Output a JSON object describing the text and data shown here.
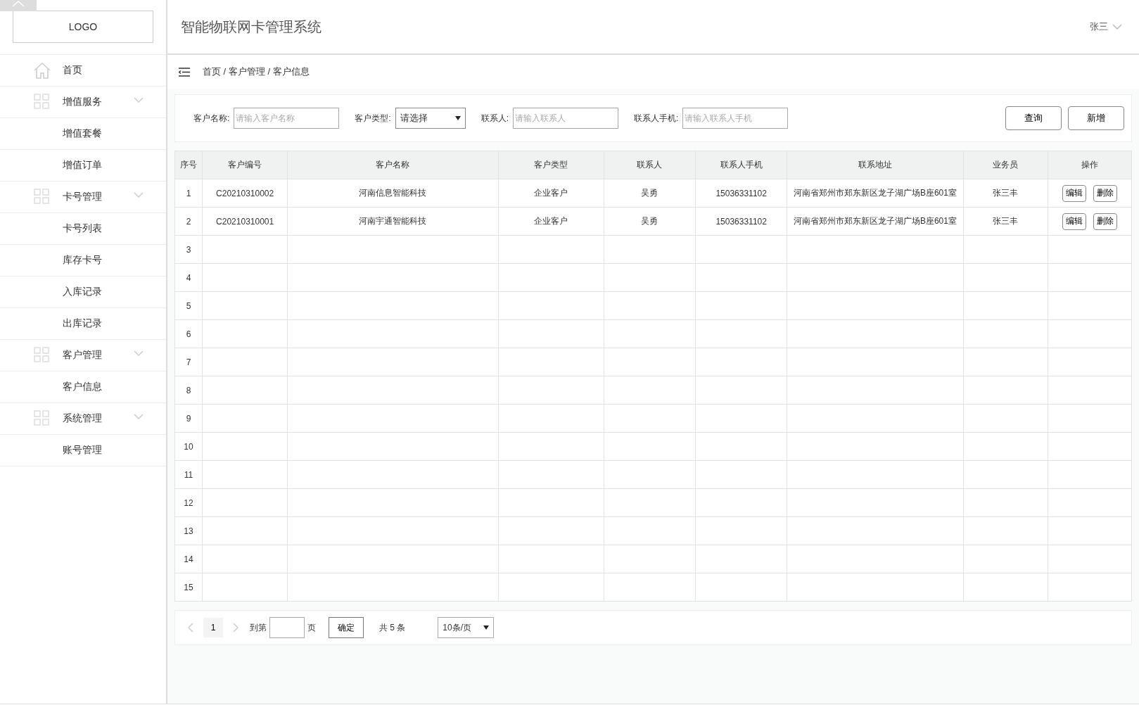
{
  "sidebar": {
    "logo": "LOGO",
    "items": [
      {
        "kind": "home",
        "label": "首页"
      },
      {
        "kind": "group",
        "label": "增值服务",
        "expanded": true,
        "children": [
          {
            "label": "增值套餐"
          },
          {
            "label": "增值订单"
          }
        ]
      },
      {
        "kind": "group",
        "label": "卡号管理",
        "expanded": true,
        "children": [
          {
            "label": "卡号列表"
          },
          {
            "label": "库存卡号"
          },
          {
            "label": "入库记录"
          },
          {
            "label": "出库记录"
          }
        ]
      },
      {
        "kind": "group",
        "label": "客户管理",
        "expanded": true,
        "children": [
          {
            "label": "客户信息"
          }
        ]
      },
      {
        "kind": "group",
        "label": "系统管理",
        "expanded": true,
        "children": [
          {
            "label": "账号管理"
          }
        ]
      }
    ]
  },
  "header": {
    "title": "智能物联网卡管理系统",
    "user": "张三"
  },
  "breadcrumb": "首页 / 客户管理 / 客户信息",
  "filters": [
    {
      "kind": "input",
      "label": "客户名称:",
      "placeholder": "请输入客户名称"
    },
    {
      "kind": "select",
      "label": "客户类型:",
      "value": "请选择"
    },
    {
      "kind": "input",
      "label": "联系人:",
      "placeholder": "请输入联系人"
    },
    {
      "kind": "input",
      "label": "联系人手机:",
      "placeholder": "请输入联系人手机"
    }
  ],
  "filter_buttons": [
    "查询",
    "新增"
  ],
  "table": {
    "columns": [
      "序号",
      "客户编号",
      "客户名称",
      "客户类型",
      "联系人",
      "联系人手机",
      "联系地址",
      "业务员",
      "操作"
    ],
    "rows": [
      {
        "cells": [
          "1",
          "C20210310002",
          "河南信息智能科技",
          "企业客户",
          "吴勇",
          "15036331102",
          "河南省郑州市郑东新区龙子湖广场B座601室",
          "张三丰"
        ],
        "actions": [
          "编辑",
          "删除"
        ]
      },
      {
        "cells": [
          "2",
          "C20210310001",
          "河南宇通智能科技",
          "企业客户",
          "吴勇",
          "15036331102",
          "河南省郑州市郑东新区龙子湖广场B座601室",
          "张三丰"
        ],
        "actions": [
          "编辑",
          "删除"
        ]
      },
      {
        "cells": [
          "3"
        ]
      },
      {
        "cells": [
          "4"
        ]
      },
      {
        "cells": [
          "5"
        ]
      },
      {
        "cells": [
          "6"
        ]
      },
      {
        "cells": [
          "7"
        ]
      },
      {
        "cells": [
          "8"
        ]
      },
      {
        "cells": [
          "9"
        ]
      },
      {
        "cells": [
          "10"
        ]
      },
      {
        "cells": [
          "11"
        ]
      },
      {
        "cells": [
          "12"
        ]
      },
      {
        "cells": [
          "13"
        ]
      },
      {
        "cells": [
          "14"
        ]
      },
      {
        "cells": [
          "15"
        ]
      }
    ]
  },
  "pagination": {
    "pages": [
      {
        "label": "1",
        "selected": true
      }
    ],
    "goto_label": "到第",
    "page_unit": "页",
    "confirm": "确定",
    "total": "共 5 条",
    "page_size": "10条/页"
  }
}
